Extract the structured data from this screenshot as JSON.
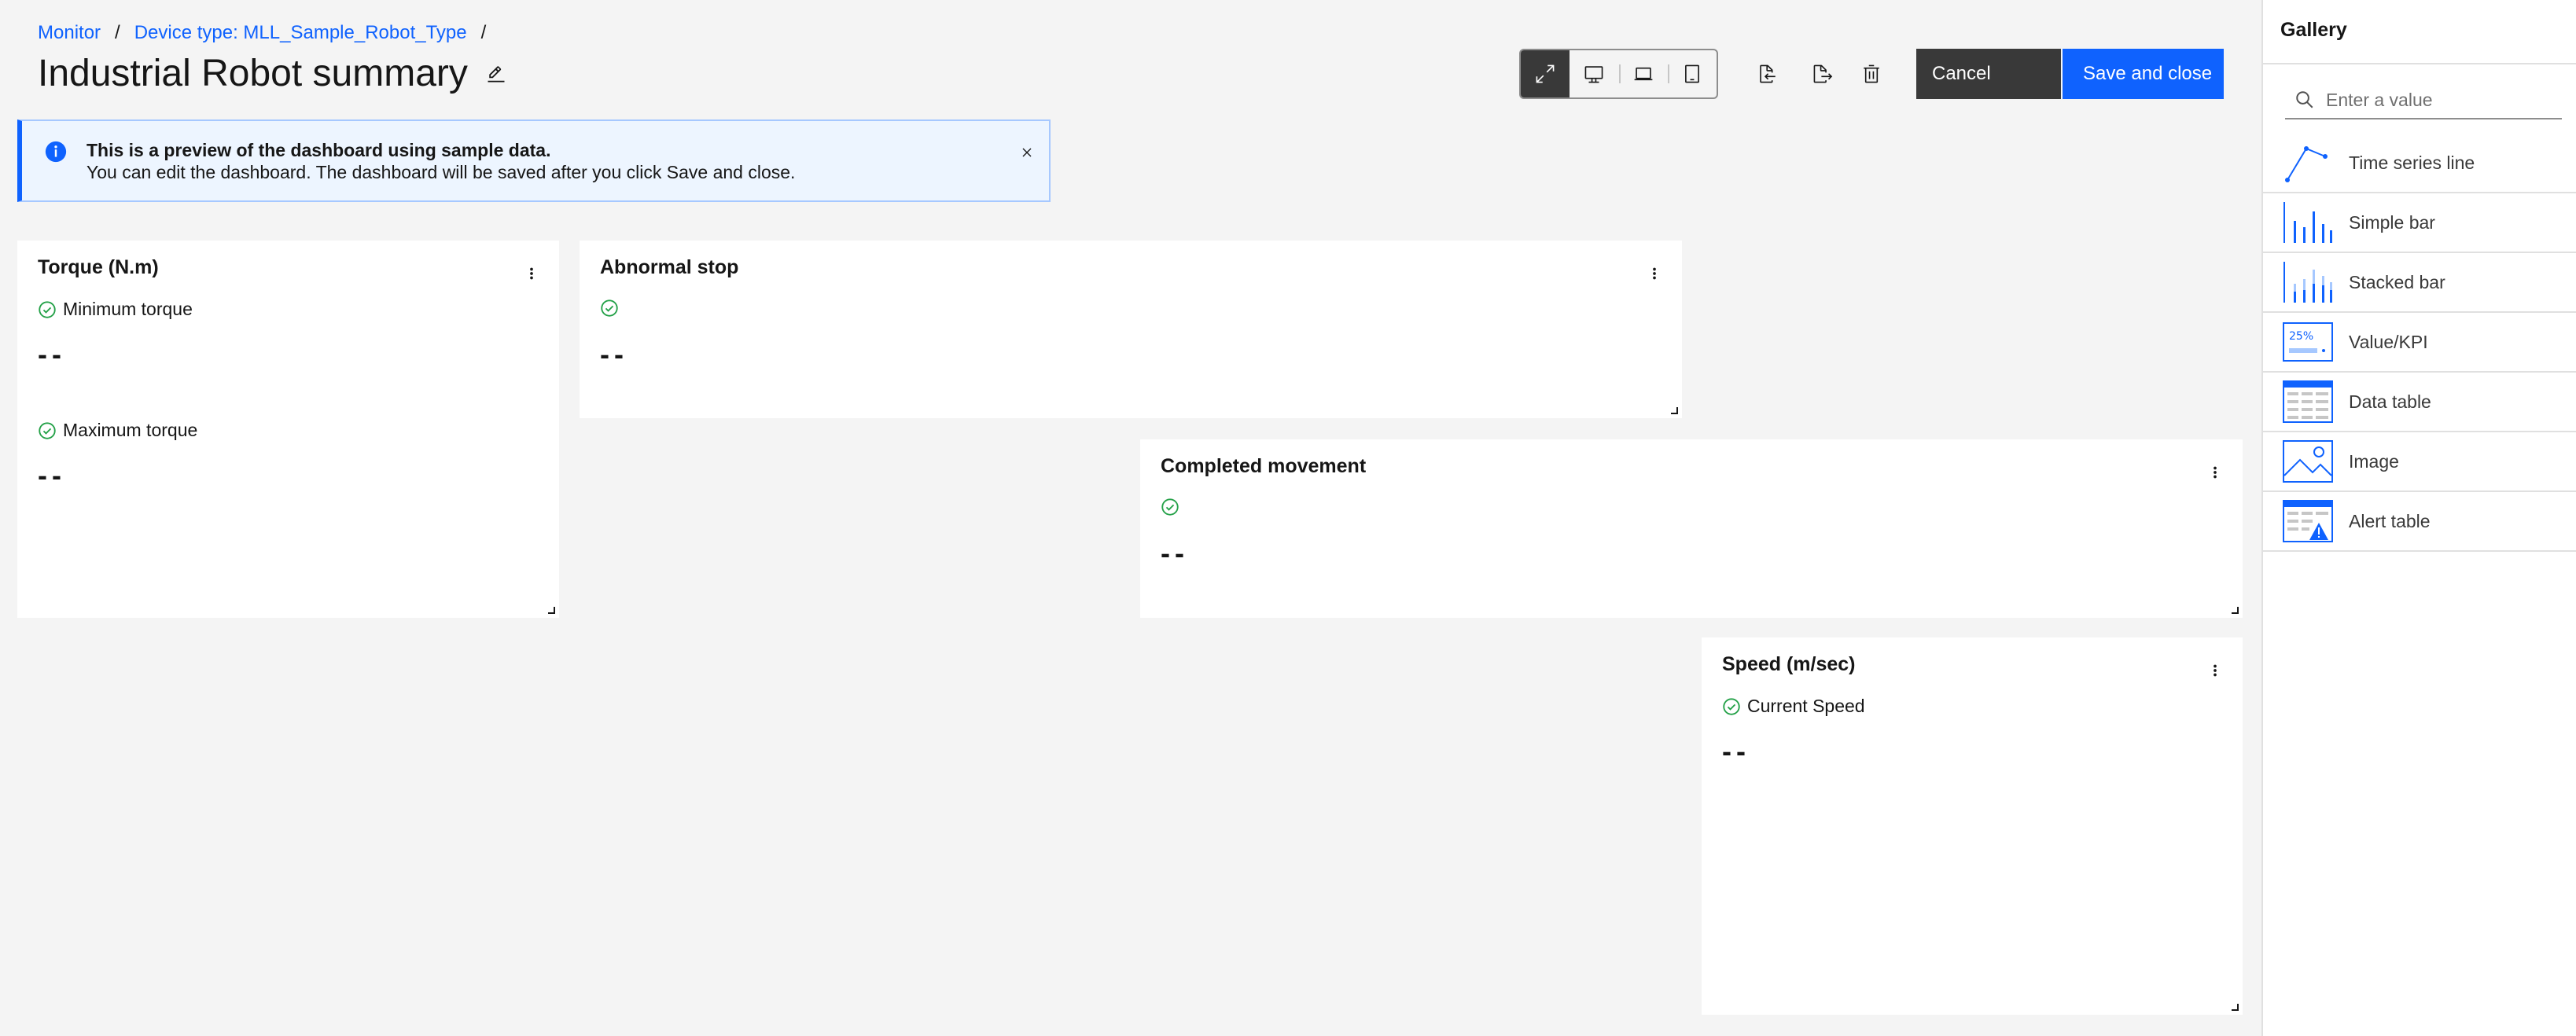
{
  "breadcrumb": {
    "items": [
      "Monitor",
      "Device type: MLL_Sample_Robot_Type"
    ],
    "separator": "/"
  },
  "page": {
    "title": "Industrial Robot summary"
  },
  "toolbar": {
    "cancel_label": "Cancel",
    "save_label": "Save and close"
  },
  "notification": {
    "title": "This is a preview of the dashboard using sample data.",
    "body": "You can edit the dashboard. The dashboard will be saved after you click Save and close."
  },
  "cards": {
    "torque": {
      "title": "Torque (N.m)",
      "metrics": [
        {
          "label": "Minimum torque",
          "value": "--"
        },
        {
          "label": "Maximum torque",
          "value": "--"
        }
      ]
    },
    "abnormal_stop": {
      "title": "Abnormal stop",
      "metrics": [
        {
          "label": "",
          "value": "--"
        }
      ]
    },
    "completed_movement": {
      "title": "Completed movement",
      "metrics": [
        {
          "label": "",
          "value": "--"
        }
      ]
    },
    "speed": {
      "title": "Speed (m/sec)",
      "metrics": [
        {
          "label": "Current Speed",
          "value": "--"
        }
      ]
    }
  },
  "gallery": {
    "title": "Gallery",
    "search_placeholder": "Enter a value",
    "items": [
      {
        "label": "Time series line",
        "icon": "line-chart-icon"
      },
      {
        "label": "Simple bar",
        "icon": "simple-bar-icon"
      },
      {
        "label": "Stacked bar",
        "icon": "stacked-bar-icon"
      },
      {
        "label": "Value/KPI",
        "icon": "kpi-icon",
        "thumb_text": "25%"
      },
      {
        "label": "Data table",
        "icon": "data-table-icon"
      },
      {
        "label": "Image",
        "icon": "image-icon"
      },
      {
        "label": "Alert table",
        "icon": "alert-table-icon"
      }
    ]
  },
  "colors": {
    "accent": "#0f62fe",
    "success": "#24a148",
    "dark_button": "#393939"
  }
}
